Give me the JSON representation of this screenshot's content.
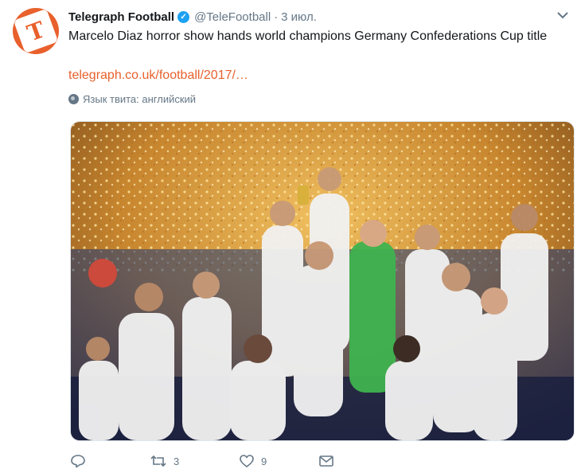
{
  "tweet": {
    "display_name": "Telegraph Football",
    "handle": "@TeleFootball",
    "separator": "·",
    "time": "3 июл.",
    "text": "Marcelo Diaz horror show hands world champions Germany Confederations Cup title",
    "link": "telegraph.co.uk/football/2017/…",
    "language": "Язык твита: английский"
  },
  "actions": {
    "reply_count": "",
    "retweet_count": "3",
    "like_count": "9"
  },
  "icons": {
    "avatar": "telegraph-logo-icon",
    "verified": "verified-badge-icon",
    "caret": "chevron-down-icon",
    "globe": "globe-icon",
    "reply": "reply-icon",
    "retweet": "retweet-icon",
    "like": "heart-icon",
    "dm": "envelope-icon"
  },
  "colors": {
    "brand": "#e8602c",
    "muted": "#657786",
    "verified": "#1da1f2",
    "text": "#14171a"
  }
}
